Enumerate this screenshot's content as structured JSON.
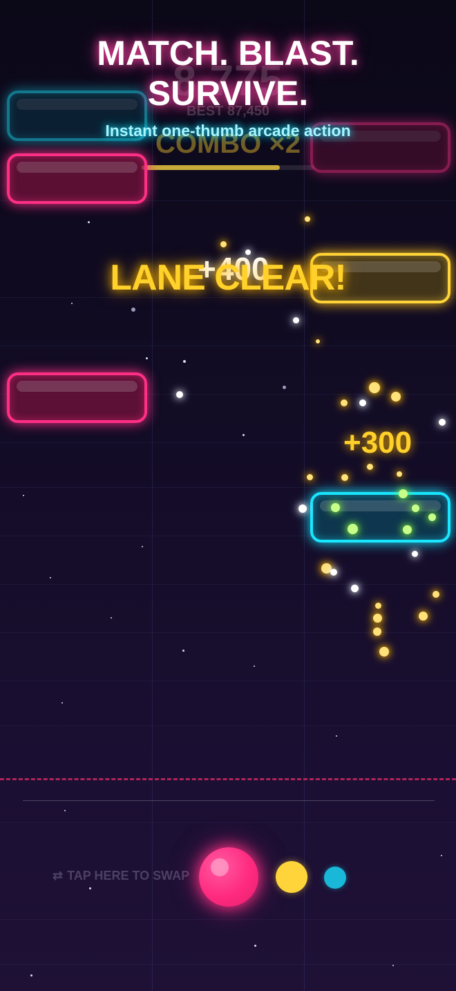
{
  "hud": {
    "score": "8 775",
    "best": "BEST 87,450",
    "combo": "COMBO ×2",
    "combo_progress": 0.8
  },
  "headline": {
    "line1": "MATCH. BLAST.",
    "line2": "SURVIVE.",
    "subtitle": "Instant one-thumb arcade action"
  },
  "popups": {
    "score_white": "+400",
    "lane_clear": "LANE CLEAR!",
    "score_yellow": "+300"
  },
  "blocks": [
    {
      "color": "cyan",
      "lane": "left",
      "state": "faded"
    },
    {
      "color": "pink",
      "lane": "left"
    },
    {
      "color": "pink",
      "lane": "right",
      "state": "faded"
    },
    {
      "color": "yellow",
      "lane": "right"
    },
    {
      "color": "pink",
      "lane": "left"
    },
    {
      "color": "cyan",
      "lane": "right"
    }
  ],
  "controls": {
    "swap_icon": "swap-arrows-icon",
    "swap_hint": "TAP HERE TO SWAP",
    "current_ball_color": "#ff2f86",
    "next_ball_colors": [
      "#ffd43b",
      "#19b8d8"
    ]
  },
  "colors": {
    "cyan": "#19e6ff",
    "pink": "#ff2f86",
    "yellow": "#ffd43b",
    "danger_line": "#b8265e"
  }
}
